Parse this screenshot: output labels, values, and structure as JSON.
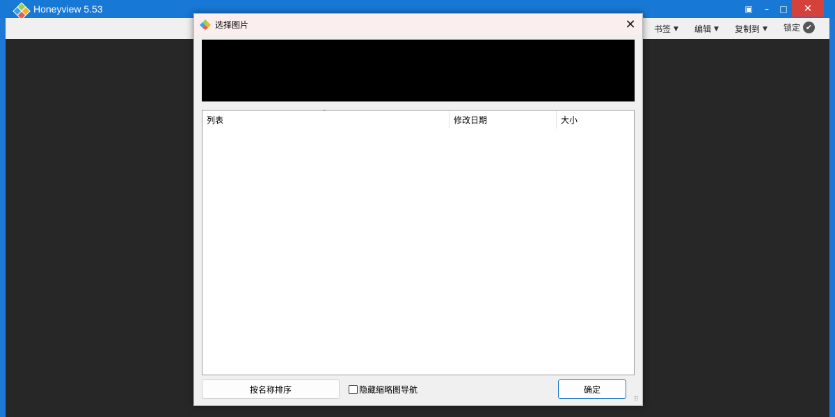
{
  "app": {
    "title": "Honeyview 5.53",
    "window_controls": {
      "snap": "▣",
      "minimize": "–",
      "maximize": "□",
      "close": "✕"
    },
    "toolbar": {
      "bookmark_label": "书签",
      "edit_label": "编辑",
      "copy_to_label": "复制到",
      "lock_label": "锁定",
      "dropdown_glyph": "▼",
      "lock_glyph": "✔"
    },
    "icon": "honeyview-logo-icon"
  },
  "dialog": {
    "title": "选择图片",
    "close_glyph": "✕",
    "list": {
      "columns": [
        "列表",
        "修改日期",
        "大小"
      ],
      "sort_indicator": "˅",
      "rows": []
    },
    "sort_button_label": "按名称排序",
    "hide_thumbnail_nav_label": "隐藏缩略图导航",
    "hide_thumbnail_nav_checked": false,
    "ok_button_label": "确定",
    "resize_grip": "⠿"
  },
  "colors": {
    "titlebar": "#1878d6",
    "close_red": "#d5423b",
    "viewer_bg": "#272727",
    "ok_border": "#1a73c9"
  }
}
